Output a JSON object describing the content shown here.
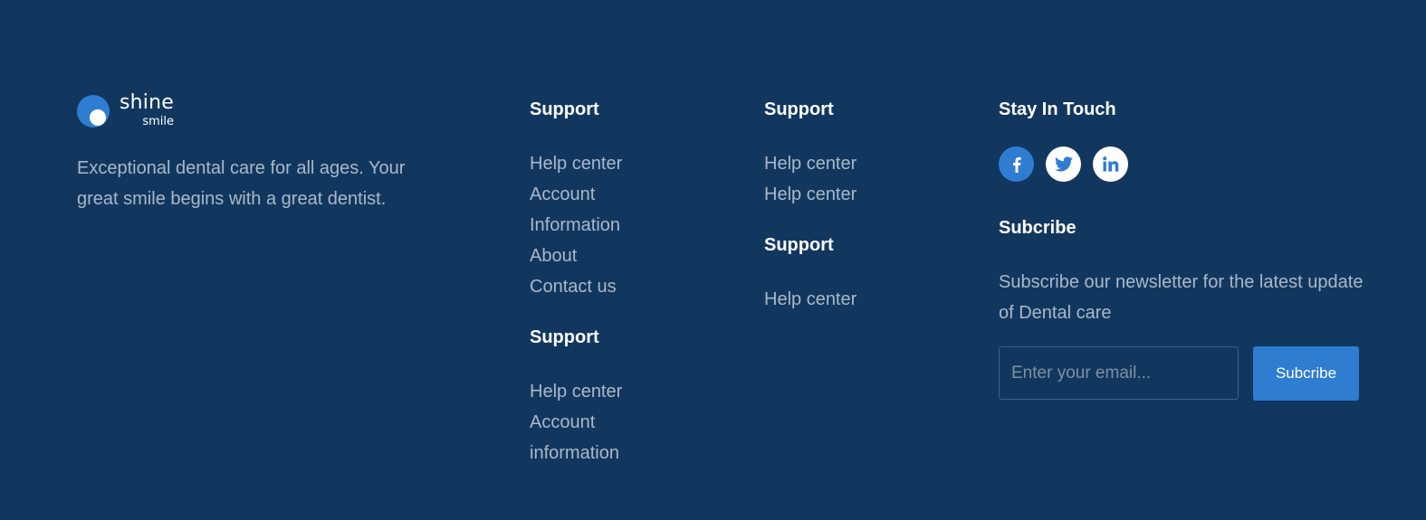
{
  "brand": {
    "logo_word": "shine",
    "logo_sub": "smile",
    "description": "Exceptional dental care for all ages. Your great smile begins with a great dentist."
  },
  "column1": {
    "groups": [
      {
        "heading": "Support",
        "links": [
          "Help center",
          "Account",
          "Information",
          "About",
          "Contact us"
        ]
      },
      {
        "heading": "Support",
        "links": [
          "Help center",
          "Account",
          "information"
        ]
      }
    ]
  },
  "column2": {
    "groups": [
      {
        "heading": "Support",
        "links": [
          "Help center",
          "Help center"
        ]
      },
      {
        "heading": "Support",
        "links": [
          "Help center"
        ]
      }
    ]
  },
  "contact": {
    "heading": "Stay In Touch",
    "socials": [
      {
        "icon": "facebook-icon",
        "glyph": "f"
      },
      {
        "icon": "twitter-icon",
        "glyph": ""
      },
      {
        "icon": "linkedin-icon",
        "glyph": "in"
      }
    ],
    "subscribe_heading": "Subcribe",
    "subscribe_description": "Subscribe our newsletter for the latest update of Dental care",
    "email_placeholder": "Enter your email...",
    "email_value": "",
    "subscribe_button": "Subcribe"
  },
  "colors": {
    "background": "#12375f",
    "accent": "#2f7dd1",
    "muted_text": "#a9b8c9",
    "heading_text": "#ffffff"
  }
}
